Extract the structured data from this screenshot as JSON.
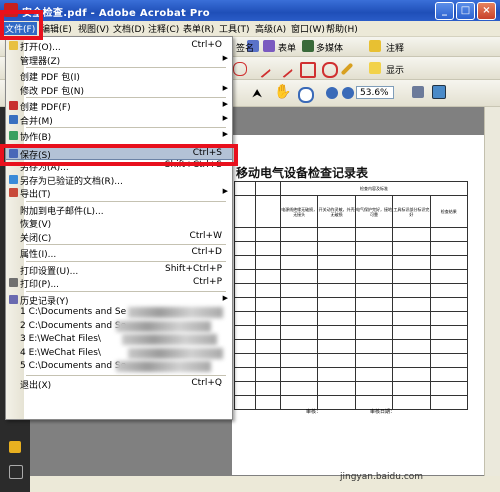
{
  "window": {
    "title": "安全检查.pdf - Adobe Acrobat Pro",
    "min": "_",
    "max": "□",
    "close": "×"
  },
  "menubar": [
    {
      "label": "文件(F)",
      "active": true
    },
    {
      "label": "编辑(E)"
    },
    {
      "label": "视图(V)"
    },
    {
      "label": "文档(D)"
    },
    {
      "label": "注释(C)"
    },
    {
      "label": "表单(R)"
    },
    {
      "label": "工具(T)"
    },
    {
      "label": "高级(A)"
    },
    {
      "label": "窗口(W)"
    },
    {
      "label": "帮助(H)"
    }
  ],
  "toolbar": {
    "sign_label": "签名",
    "form_label": "表单",
    "multimedia_label": "多媒体",
    "comment_label": "注释",
    "show_label": "显示",
    "zoom": "53.6%"
  },
  "file_menu": [
    {
      "label": "打开(O)...",
      "shortcut": "Ctrl+O",
      "icon": "open-folder-icon"
    },
    {
      "label": "管理器(Z)",
      "submenu": true
    },
    {
      "sep": true
    },
    {
      "label": "创建 PDF 包(I)",
      "icon": ""
    },
    {
      "label": "修改 PDF 包(N)",
      "submenu": true
    },
    {
      "sep": true
    },
    {
      "label": "创建 PDF(F)",
      "submenu": true,
      "icon": "create-pdf-icon"
    },
    {
      "label": "合并(M)",
      "submenu": true,
      "icon": "combine-icon"
    },
    {
      "sep": true
    },
    {
      "label": "协作(B)",
      "submenu": true,
      "icon": "collaborate-icon"
    },
    {
      "sep": true
    },
    {
      "label": "保存(S)",
      "shortcut": "Ctrl+S",
      "icon": "save-icon",
      "highlighted": true
    },
    {
      "label": "另存为(A)...",
      "shortcut": "Shift+Ctrl+S"
    },
    {
      "label": "另存为已验证的文档(R)...",
      "icon": "certified-icon"
    },
    {
      "label": "导出(T)",
      "submenu": true,
      "icon": "export-icon"
    },
    {
      "sep": true
    },
    {
      "label": "附加到电子邮件(L)..."
    },
    {
      "label": "恢复(V)"
    },
    {
      "label": "关闭(C)",
      "shortcut": "Ctrl+W"
    },
    {
      "sep": true
    },
    {
      "label": "属性(I)...",
      "shortcut": "Ctrl+D"
    },
    {
      "sep": true
    },
    {
      "label": "打印设置(U)...",
      "shortcut": "Shift+Ctrl+P"
    },
    {
      "label": "打印(P)...",
      "shortcut": "Ctrl+P",
      "icon": "print-icon"
    },
    {
      "sep": true
    },
    {
      "label": "历史记录(Y)",
      "submenu": true,
      "icon": "history-icon"
    },
    {
      "label": "1 C:\\Documents and Se",
      "blurred": true
    },
    {
      "label": "2 C:\\Documents and Se",
      "blurred": true
    },
    {
      "label": "3 E:\\WeChat Files\\",
      "blurred": true
    },
    {
      "label": "4 E:\\WeChat Files\\",
      "blurred": true
    },
    {
      "label": "5 C:\\Documents and Se",
      "blurred": true
    },
    {
      "sep": true
    },
    {
      "label": "退出(X)",
      "shortcut": "Ctrl+Q"
    }
  ],
  "document": {
    "title": "移动电气设备检查记录表",
    "table_header": "检查内容及标准",
    "columns": [
      "",
      "",
      "电源线绝缘无破损，无接头",
      "开关动作灵敏，外壳无破损",
      "电气保护完好，接地可靠",
      "工具标识部分标识完好",
      "检查结果"
    ],
    "footer_left": "审核：",
    "footer_right": "审核日期："
  },
  "watermark": "jingyan.baidu.com"
}
